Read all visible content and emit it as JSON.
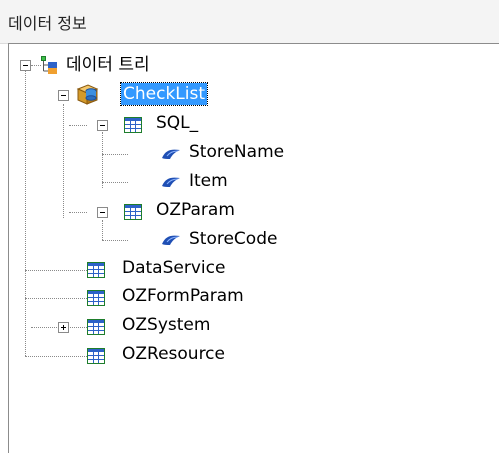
{
  "panel": {
    "title": "데이터 정보"
  },
  "tree": {
    "root": {
      "label": "데이터 트리",
      "icon": "tree-root-icon"
    },
    "checklist": {
      "label": "CheckList",
      "icon": "database-icon",
      "selected": true
    },
    "sql": {
      "label": "SQL_",
      "icon": "table-icon"
    },
    "storename": {
      "label": "StoreName",
      "icon": "field-icon"
    },
    "item": {
      "label": "Item",
      "icon": "field-icon"
    },
    "ozparam": {
      "label": "OZParam",
      "icon": "table-icon"
    },
    "storecode": {
      "label": "StoreCode",
      "icon": "field-icon"
    },
    "dataservice": {
      "label": "DataService",
      "icon": "table-icon"
    },
    "ozformparam": {
      "label": "OZFormParam",
      "icon": "table-icon"
    },
    "ozsystem": {
      "label": "OZSystem",
      "icon": "table-icon",
      "collapsed": true
    },
    "ozresource": {
      "label": "OZResource",
      "icon": "table-icon"
    }
  },
  "colors": {
    "selection": "#3399ff",
    "table_border": "#1e7d2c",
    "grid_blue": "#2d62c8",
    "field_blue": "#1f4fb4"
  }
}
